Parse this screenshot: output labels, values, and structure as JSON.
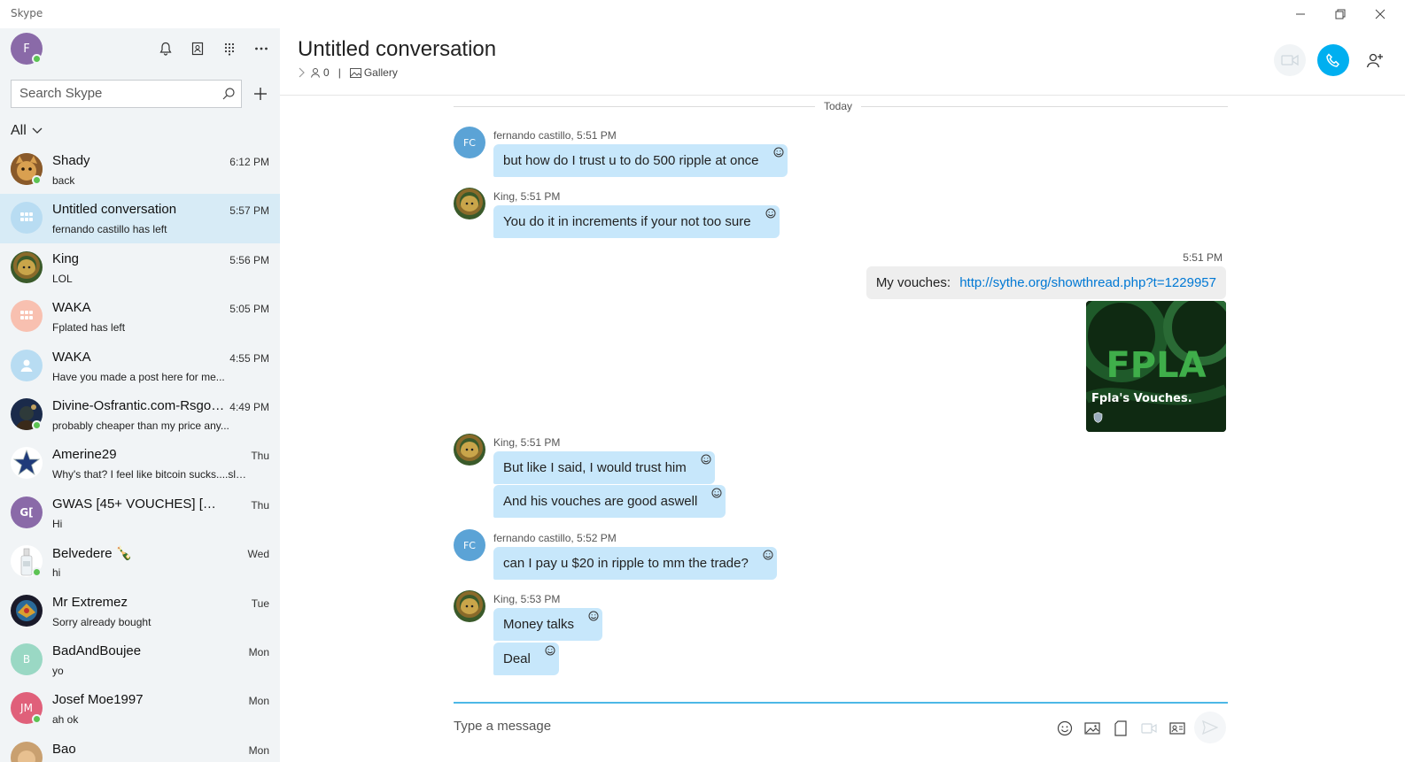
{
  "window": {
    "app_title": "Skype"
  },
  "sidebar": {
    "me_initial": "F",
    "search": {
      "placeholder": "Search Skype"
    },
    "filter_label": "All",
    "chats": [
      {
        "name": "Shady",
        "preview": "back",
        "time": "6:12 PM",
        "avatar": "photo",
        "online": true
      },
      {
        "name": "Untitled conversation",
        "preview": "fernando castillo has left",
        "time": "5:57 PM",
        "avatar": "group",
        "online": false,
        "active": true
      },
      {
        "name": "King",
        "preview": "LOL",
        "time": "5:56 PM",
        "avatar": "photo",
        "online": false
      },
      {
        "name": "WAKA",
        "preview": "Fplated has left",
        "time": "5:05 PM",
        "avatar": "group",
        "online": false
      },
      {
        "name": "WAKA",
        "preview": "Have you made a post here for me...",
        "time": "4:55 PM",
        "avatar": "person",
        "online": false
      },
      {
        "name": "Divine-Osfrantic.com-Rsgol...",
        "preview": "probably cheaper than my price any...",
        "time": "4:49 PM",
        "avatar": "photo",
        "online": true
      },
      {
        "name": "Amerine29",
        "preview": "Why's that? I feel like bitcoin sucks....slo...",
        "time": "Thu",
        "avatar": "star",
        "online": false
      },
      {
        "name": "GWAS [45+ VOUCHES] [DONO...",
        "preview": "Hi",
        "time": "Thu",
        "avatar": "G[",
        "online": false
      },
      {
        "name": "Belvedere 🍾",
        "preview": "hi",
        "time": "Wed",
        "avatar": "bottle",
        "online": true
      },
      {
        "name": "Mr Extremez",
        "preview": "Sorry already bought",
        "time": "Tue",
        "avatar": "photo",
        "online": false
      },
      {
        "name": "BadAndBoujee",
        "preview": "yo",
        "time": "Mon",
        "avatar": "B",
        "online": false
      },
      {
        "name": "Josef Moe1997",
        "preview": "ah ok",
        "time": "Mon",
        "avatar": "JM",
        "online": true
      },
      {
        "name": "Bao",
        "preview": "",
        "time": "Mon",
        "avatar": "photo",
        "online": false
      }
    ]
  },
  "conversation": {
    "title": "Untitled conversation",
    "participants": "0",
    "separator": "|",
    "gallery_label": "Gallery",
    "day_label": "Today",
    "fc_initials": "FC",
    "messages": [
      {
        "sender": "fernando castillo, 5:51 PM",
        "texts": [
          "but how do I trust u to do 500 ripple at once"
        ]
      },
      {
        "sender": "King, 5:51 PM",
        "texts": [
          "You do it in increments if your not too sure"
        ]
      },
      {
        "sender": "King, 5:51 PM",
        "texts": [
          "But like I said, I would trust him",
          "And his vouches are good aswell"
        ]
      },
      {
        "sender": "fernando castillo, 5:52 PM",
        "texts": [
          "can I pay u $20 in ripple to mm the trade?"
        ]
      },
      {
        "sender": "King, 5:53 PM",
        "texts": [
          "Money talks",
          "Deal"
        ]
      }
    ],
    "my_message": {
      "time": "5:51 PM",
      "label": "My vouches:",
      "link": "http://sythe.org/showthread.php?t=1229957",
      "preview_caption": "Fpla's Vouches.",
      "preview_logo_text": "FPLA"
    },
    "composer": {
      "placeholder": "Type a message"
    }
  },
  "colors": {
    "accent": "#00aff0",
    "bubble": "#c7e7fb",
    "online": "#5cc353"
  }
}
